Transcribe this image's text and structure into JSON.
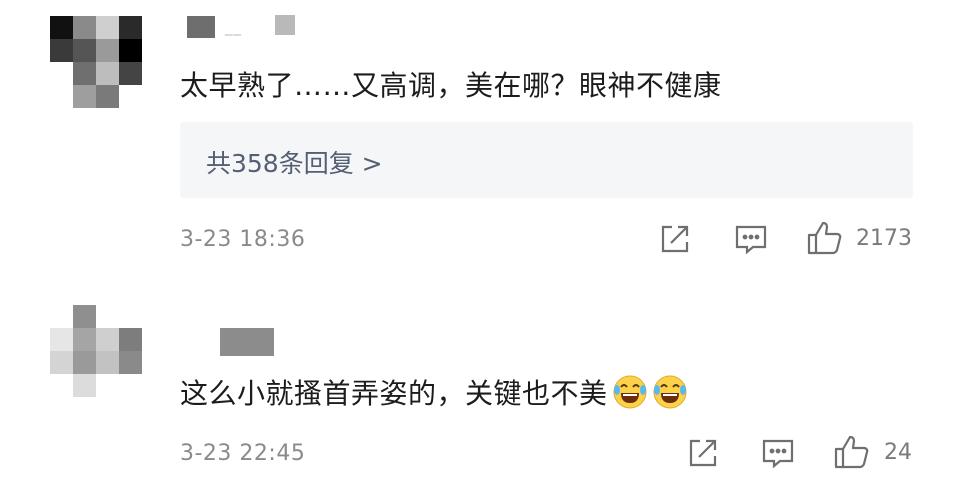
{
  "comments": [
    {
      "username": "__",
      "text": "太早熟了……又高调，美在哪？眼神不健康",
      "replies_label": "共358条回复 >",
      "timestamp": "3-23 18:36",
      "likes": "2173",
      "icons": [
        "share-icon",
        "comment-icon",
        "thumbs-up-icon"
      ]
    },
    {
      "username": "",
      "text": "这么小就搔首弄姿的，关键也不美",
      "timestamp": "3-23 22:45",
      "likes": "24",
      "emoji": [
        "laughing-crying-emoji",
        "laughing-crying-emoji"
      ],
      "icons": [
        "share-icon",
        "comment-icon",
        "thumbs-up-icon"
      ]
    }
  ]
}
